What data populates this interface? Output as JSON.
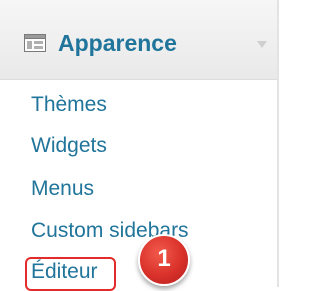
{
  "menu": {
    "title": "Apparence",
    "icon": "appearance-icon",
    "arrow_icon": "chevron-down-icon"
  },
  "items": [
    {
      "label": "Thèmes"
    },
    {
      "label": "Widgets"
    },
    {
      "label": "Menus"
    },
    {
      "label": "Custom sidebars"
    },
    {
      "label": "Éditeur"
    }
  ],
  "annotation": {
    "step_number": "1",
    "highlight_color": "#e32b2b",
    "badge_color": "#d9312a"
  },
  "colors": {
    "link": "#21759b",
    "header_bg": "#efefef"
  }
}
